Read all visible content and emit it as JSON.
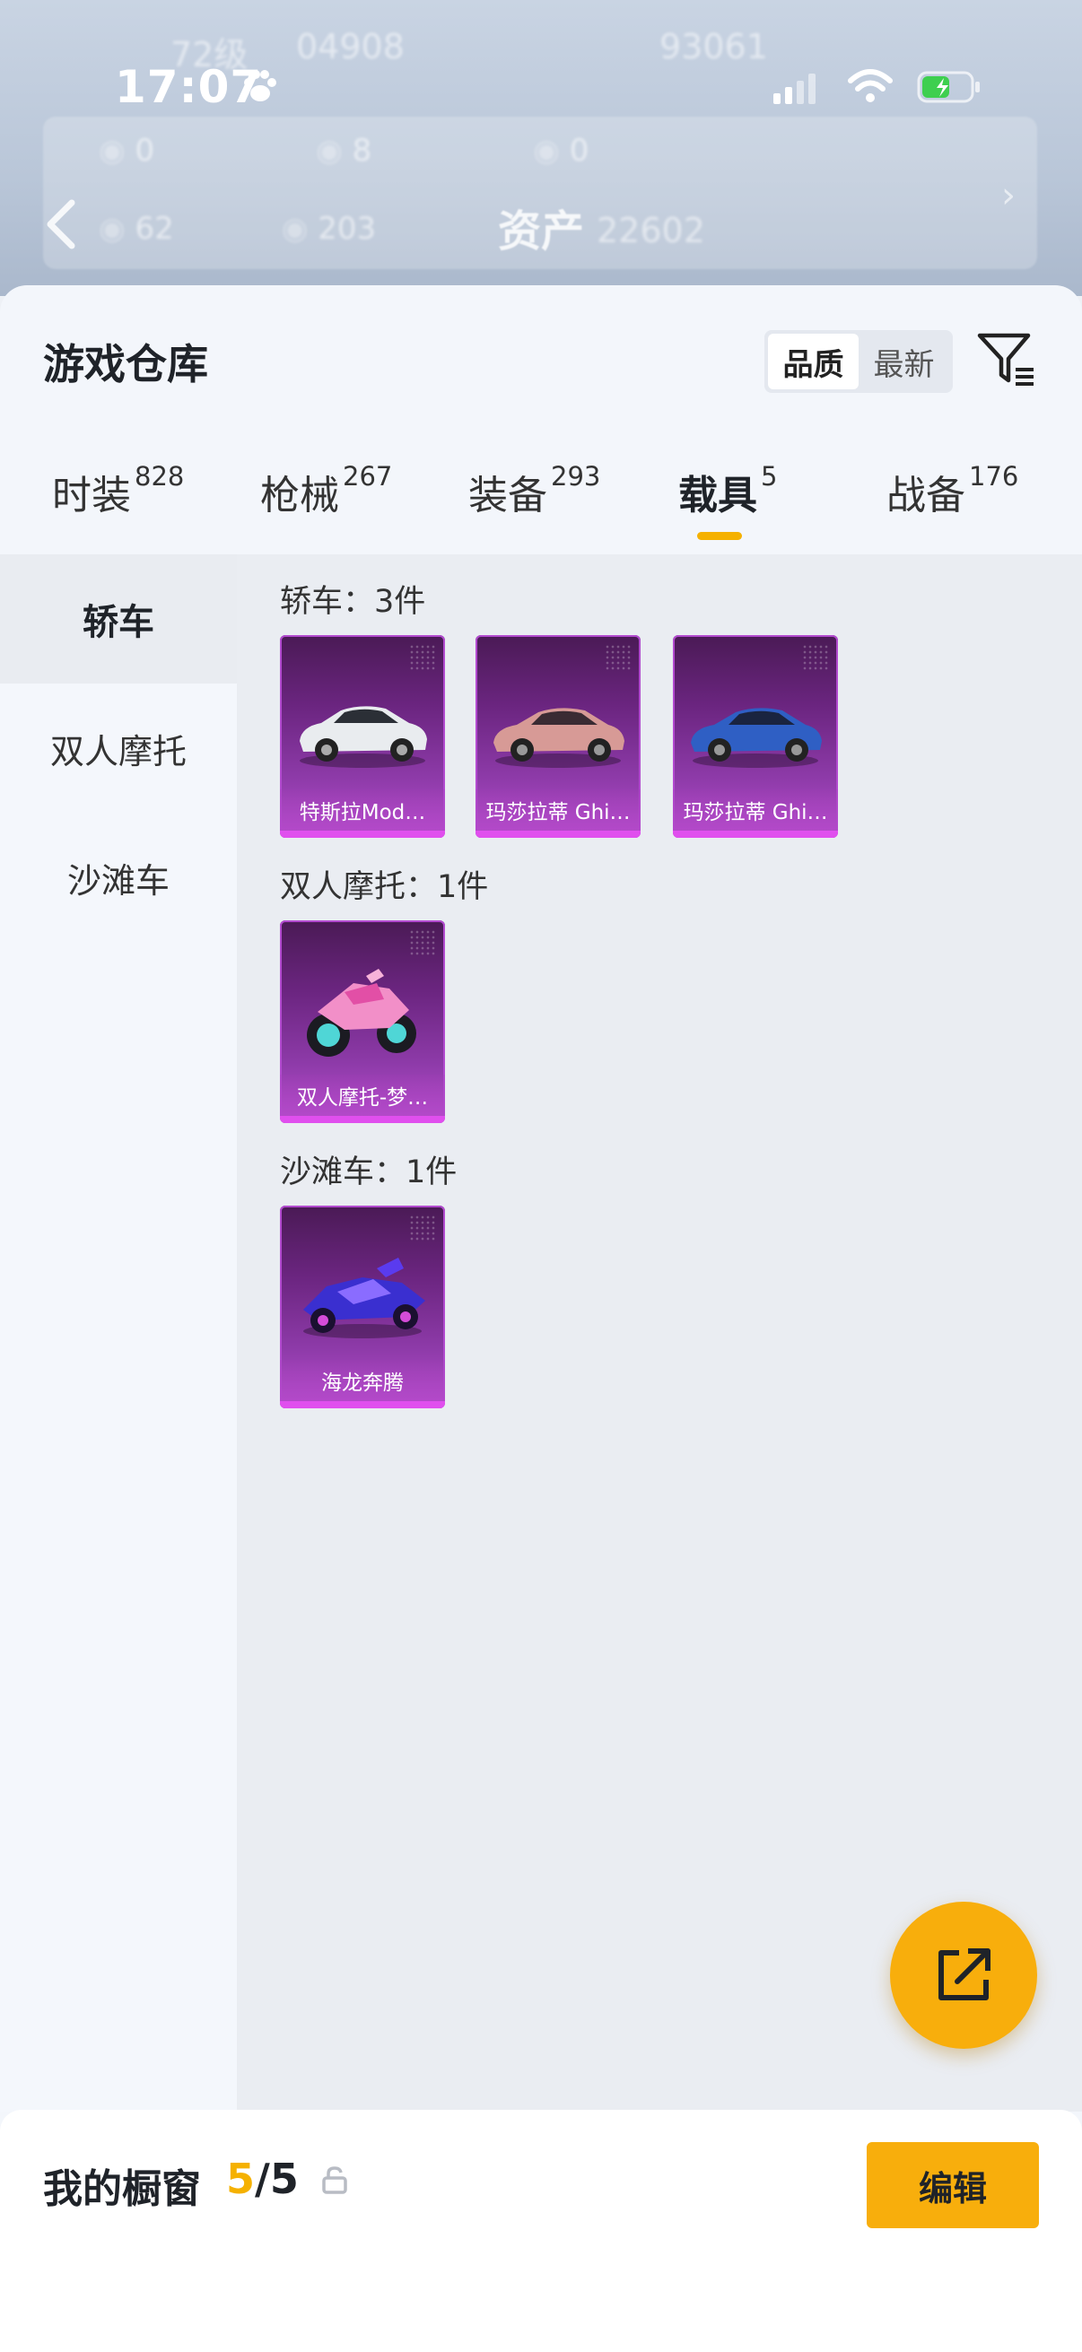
{
  "status_bar": {
    "time": "17:07"
  },
  "background": {
    "level": "72级",
    "count_a": "04908",
    "count_b": "93061",
    "row1": [
      "0",
      "8",
      "0"
    ],
    "row2": [
      "62",
      "203",
      "22602"
    ],
    "asset_title": "资产"
  },
  "header": {
    "title": "游戏仓库",
    "sort_options": [
      "品质",
      "最新"
    ],
    "active_sort": "品质"
  },
  "tabs": [
    {
      "label": "时装",
      "count": "828"
    },
    {
      "label": "枪械",
      "count": "267"
    },
    {
      "label": "装备",
      "count": "293"
    },
    {
      "label": "载具",
      "count": "5"
    },
    {
      "label": "战备",
      "count": "176"
    }
  ],
  "active_tab": "载具",
  "side_nav": [
    {
      "label": "轿车"
    },
    {
      "label": "双人摩托"
    },
    {
      "label": "沙滩车"
    }
  ],
  "groups": [
    {
      "label": "轿车：3件",
      "items": [
        {
          "name": "特斯拉Mod…",
          "icon": "white-sedan"
        },
        {
          "name": "玛莎拉蒂 Ghi…",
          "icon": "pink-sedan"
        },
        {
          "name": "玛莎拉蒂 Ghi…",
          "icon": "blue-sedan"
        }
      ]
    },
    {
      "label": "双人摩托：1件",
      "items": [
        {
          "name": "双人摩托-梦…",
          "icon": "pink-motorcycle"
        }
      ]
    },
    {
      "label": "沙滩车：1件",
      "items": [
        {
          "name": "海龙奔腾",
          "icon": "purple-buggy"
        }
      ]
    }
  ],
  "bottom_bar": {
    "label": "我的橱窗",
    "count_current": "5",
    "count_sep_total": "/5",
    "edit_label": "编辑"
  },
  "colors": {
    "accent": "#f8ae0c",
    "card_purple": "#8d3aa8",
    "card_border": "#e04fee"
  }
}
